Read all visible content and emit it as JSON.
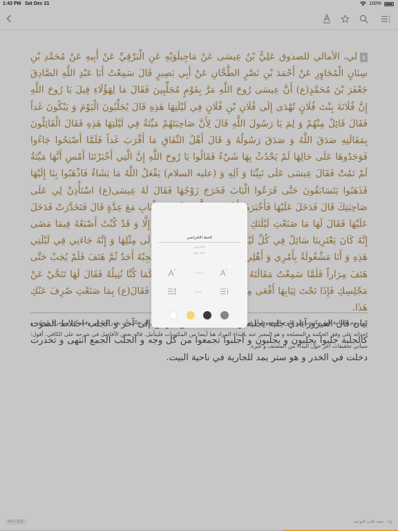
{
  "status_bar": {
    "time": "1:43 PM",
    "date": "Sat Dec 21",
    "battery": "100%"
  },
  "toolbar": {
    "back_icon": "chevron-left-icon",
    "font_icon": "text-size-icon",
    "bookmark_icon": "star-icon",
    "search_icon": "search-icon",
    "contents_icon": "list-icon"
  },
  "content": {
    "paragraph_number": "١",
    "hadith_text": "لي، الأمالي للصدوق عَلِيُّ بْنُ عِيسَى عَنْ مَاجِيلَوَيْهِ عَنِ الْبَرْقِيِّ عَنْ أَبِيهِ عَنْ مُحَمَّدِ بْنِ سِنَانٍ الْمُجَاوِرِ عَنْ أَحْمَدَ بْنِ نَصْرٍ الطَّحَّانِ عَنْ أَبِي بَصِيرٍ قَالَ سَمِعْتُ أَبَا عَبْدِ اللَّهِ الصَّادِقَ جَعْفَرَ بْنَ مُحَمَّدٍ(ع) أَنَّ عِيسَى رُوحَ اللَّهِ مَرَّ بِقَوْمٍ مُجَلِّبِينَ فَقَالَ مَا لِهَؤُلَاءِ قِيلَ يَا رُوحَ اللَّهِ إِنَّ فُلَانَةَ بِنْتَ فُلَانٍ تُهْدَى إِلَى فُلَانِ بْنِ فُلَانٍ فِي لَيْلَتِهَا هَذِهِ قَالَ يُجَلِّبُونَ الْيَوْمَ وَ يَبْكُونَ غَداً فَقَالَ قَائِلٌ مِنْهُمْ وَ لِمَ يَا رَسُولَ اللَّهِ قَالَ لِأَنَّ صَاحِبَتَهُمْ مَيِّتَةٌ فِي لَيْلَتِهَا هَذِهِ فَقَالَ الْقَائِلُونَ بِمَقَالَتِهِ صَدَقَ اللَّهُ وَ صَدَقَ رَسُولُهُ وَ قَالَ أَهْلُ النِّفَاقِ مَا أَقْرَبَ غَداً فَلَمَّا أَصْبَحُوا جَاءُوا فَوَجَدُوهَا عَلَى حَالِهَا لَمْ يَحْدُثْ بِهَا شَيْءٌ فَقَالُوا يَا رُوحَ اللَّهِ إِنَّ الَّتِي أَخْبَرْتَنَا أَمْسِ أَنَّهَا مَيِّتَةٌ لَمْ تَمُتْ فَقَالَ عِيسَى عَلَى نَبِيِّنَا وَ آلِهِ وَ (عليه السلام) يَفْعَلُ اللَّهُ مَا يَشَاءُ فَاذْهَبُوا بِنَا إِلَيْهَا فَذَهَبُوا يَتَسَابَقُونَ حَتَّى قَرَعُوا الْبَابَ فَخَرَجَ زَوْجُهَا فَقَالَ لَهُ عِيسَى(ع) اسْتَأْذِنْ لِي عَلَى صَاحِبَتِكَ قَالَ فَدَخَلَ عَلَيْهَا فَأَخْبَرَهَا أَنَّ رُوحَ اللَّهِ وَ كَلِمَتَهُ بِالْبَابِ مَعَ عِدَّةٍ قَالَ فَتَخَدَّرَتْ فَدَخَلَ عَلَيْهَا فَقَالَ لَهَا مَا صَنَعْتِ لَيْلَتَكِ هَذِهِ قَالَتْ لَمْ أَصْنَعْ شَيْئاً إِلَّا وَ قَدْ كُنْتُ أَصْنَعُهُ فِيمَا مَضَى إِنَّهُ كَانَ يَعْتَرِينَا سَائِلٌ فِي كُلِّ لَيْلَةِ جُمُعَةٍ فَنُنِيلُهُ مَا يَقُوتُهُ إِلَى مِثْلِهَا وَ إِنَّهُ جَاءَنِي فِي لَيْلَتِي هَذِهِ وَ أَنَا مَشْغُولَةٌ بِأَمْرِي وَ أَهْلِي فِي مَشَاغِلَ فَهَتَفَ فَلَمْ يُجِبْهُ أَحَدٌ ثُمَّ هَتَفَ فَلَمْ يُجَبْ حَتَّى هَتَفَ مِرَاراً فَلَمَّا سَمِعْتُ مَقَالَتَهُ قُمْتُ مُتَنَكِّرَةً حَتَّى أَنَلْتُهُ كَمَا كُنَّا نُنِيلُهُ فَقَالَ لَهَا تَنَحَّيْ عَنْ مَجْلِسِكِ فَإِذَا تَحْتَ ثِيَابِهَا أَفْعَى مِثْلُ جِذْعَةٍ عَاضٌّ عَلَى ذَنَبِهِ فَقَالَ(ع) بِمَا صَنَعْتِ صُرِفَ عَنْكِ هَذَا.",
    "commentary_text": "بيان قال الفيروزآبادي جلبه يجلبه و يجلبه ساقه من موضع إلى آخر و الجلب اختلاط الصوت كالجلبة جلبوا يجلبون و يجلبون و أجلبوا تجمعوا من كل وجه و الجلب الجمع انتهى و تخدرت دخلت في الخدر و هو ستر يمد للجارية في ناحية البيت.",
    "footnote_text": "الى يوم القيامة فهو مكتوب في اللوح المحفوظ أو في صحف الملائكة، و من المكتوب و المعلوم له تعالى أن يقدر كذا في وقت كذا و يتدرج بإيجاده و احداثه على وفق الحكمة و المصلحة و هو المعبر عنه بالبداء المراد هنا أيضا من المكتوبات فليتأمل. قاله بعض الأفاضل في شرحه على الكافي. أقول: سيأتي تحقيقات أخر حول البداء من المصنف و غيره."
  },
  "footer": {
    "page_counter": "64 / 324",
    "chapter_label": "ج٤ - تتمة كتاب التوحيد",
    "progress": 0.29
  },
  "font_popup": {
    "font_name": "الخط الافتراضي",
    "font_option_1": "خط وزير",
    "font_option_2": "خط نسخ",
    "font_size_value": "100%",
    "line_spacing_value": "80%",
    "decrease_font_icon": "text-smaller-icon",
    "increase_font_icon": "text-larger-icon",
    "line_spacing_icon": "line-spacing-icon",
    "paragraph_spacing_icon": "paragraph-spacing-icon",
    "themes": [
      {
        "name": "white",
        "color": "#ffffff"
      },
      {
        "name": "sepia",
        "color": "#f5d77a"
      },
      {
        "name": "dark",
        "color": "#3a3a3a"
      },
      {
        "name": "gray",
        "color": "#858585"
      }
    ]
  }
}
